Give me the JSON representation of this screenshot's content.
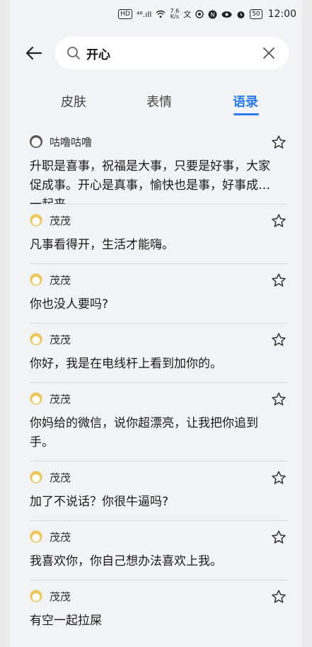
{
  "status_bar": {
    "hd": "HD",
    "net": "⁴⁶.ıll",
    "speed_top": "7.6",
    "speed_bottom": "K/s",
    "battery": "50",
    "time": "12:00"
  },
  "search": {
    "query": "开心"
  },
  "tabs": [
    {
      "label": "皮肤"
    },
    {
      "label": "表情"
    },
    {
      "label": "语录"
    }
  ],
  "active_tab": "语录",
  "quotes": [
    {
      "user": "咕噜咕噜",
      "avatar": "panda-avatar",
      "text": "升职是喜事，祝福是大事，只要是好事，大家促成事。开心是真事，愉快也是事，好事成双一起来。"
    },
    {
      "user": "茂茂",
      "avatar": "cartoon-avatar",
      "text": "凡事看得开，生活才能嗨。"
    },
    {
      "user": "茂茂",
      "avatar": "cartoon-avatar",
      "text": "你也没人要吗?"
    },
    {
      "user": "茂茂",
      "avatar": "cartoon-avatar",
      "text": "你好，我是在电线杆上看到加你的。"
    },
    {
      "user": "茂茂",
      "avatar": "cartoon-avatar",
      "text": "你妈给的微信，说你超漂亮，让我把你追到手。"
    },
    {
      "user": "茂茂",
      "avatar": "cartoon-avatar",
      "text": "加了不说话？你很牛逼吗?"
    },
    {
      "user": "茂茂",
      "avatar": "cartoon-avatar",
      "text": "我喜欢你，你自己想办法喜欢上我。"
    },
    {
      "user": "茂茂",
      "avatar": "cartoon-avatar",
      "text": "有空一起拉屎"
    }
  ],
  "colors": {
    "accent": "#2a7cf5",
    "background": "#f1f3f5"
  }
}
